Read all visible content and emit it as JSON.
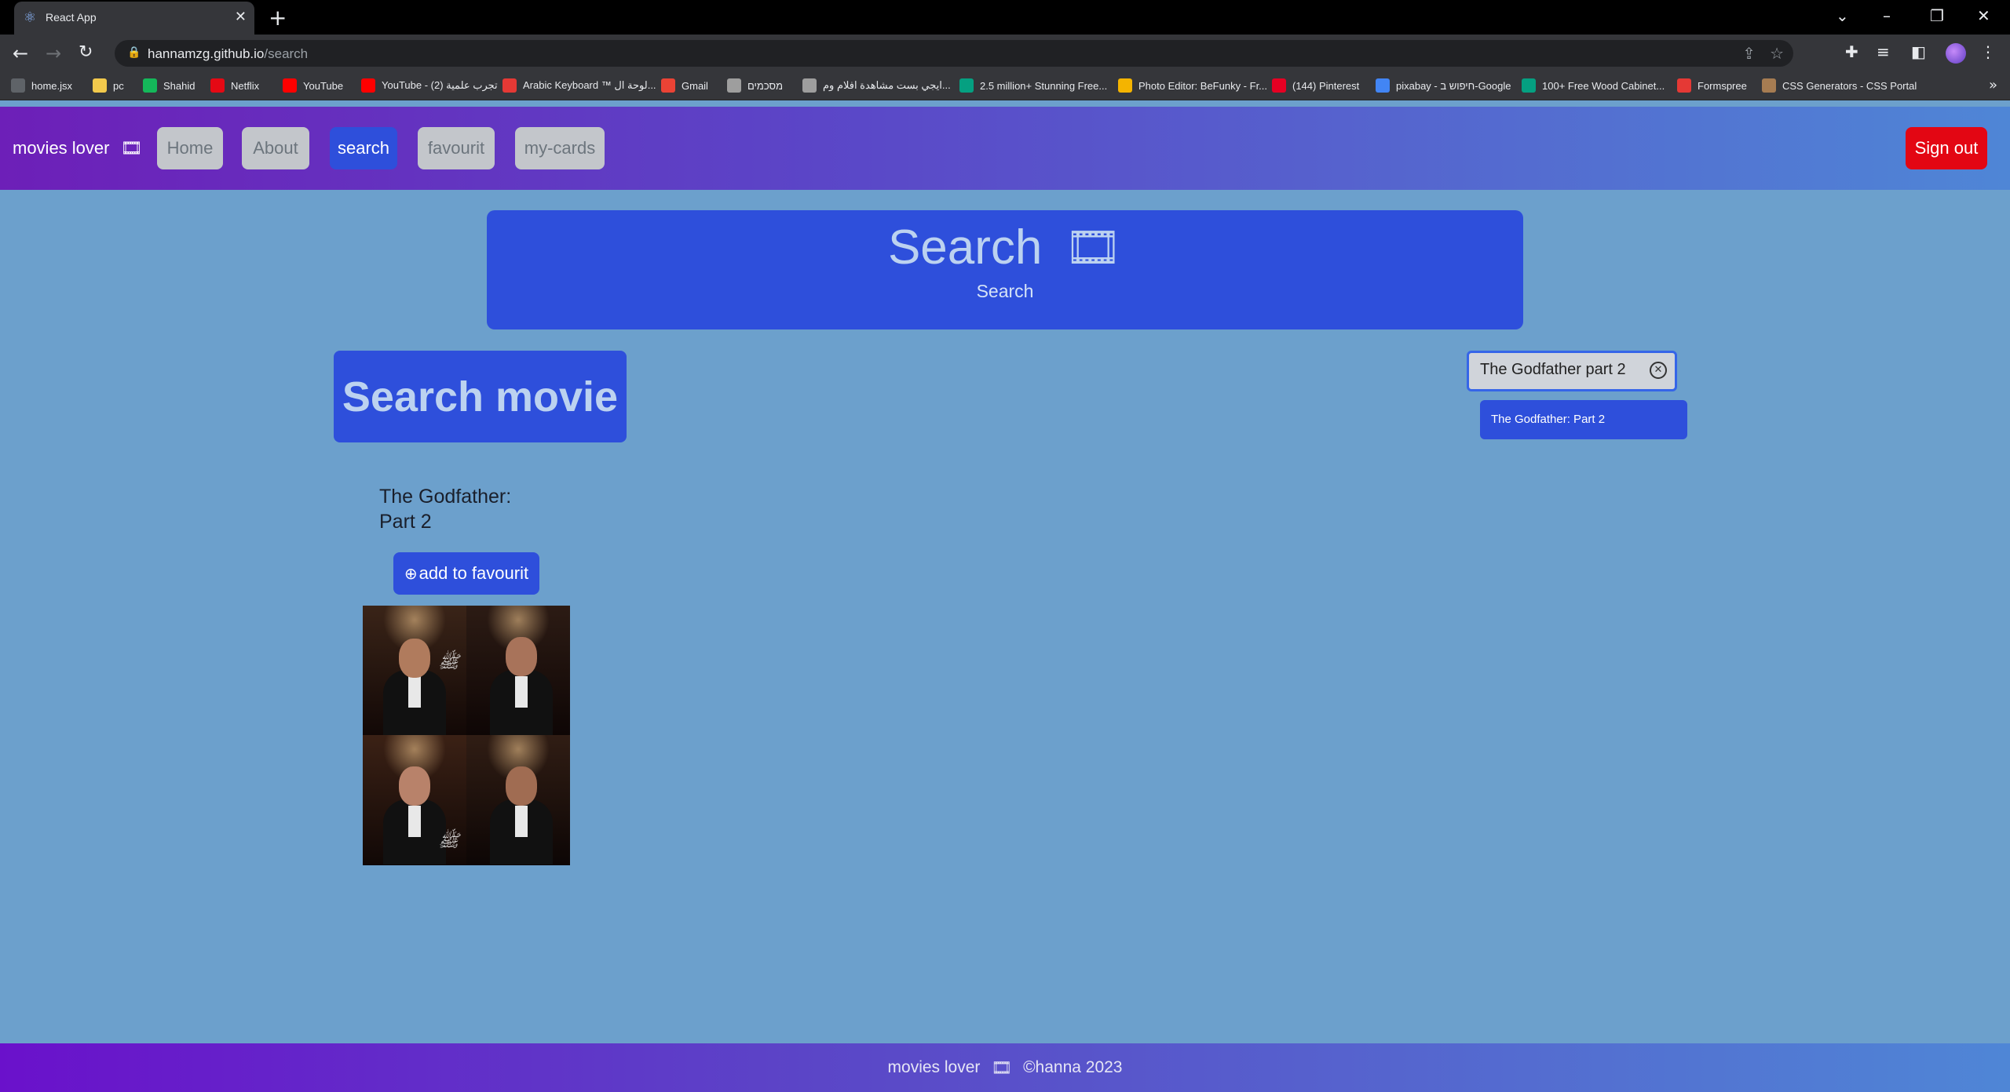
{
  "browser": {
    "tab_title": "React App",
    "url_host": "hannamzg.github.io",
    "url_path": "/search",
    "bookmarks": [
      {
        "label": "home.jsx",
        "color": "#5f6368"
      },
      {
        "label": "pc",
        "color": "#f2c94c"
      },
      {
        "label": "Shahid",
        "color": "#14b85a"
      },
      {
        "label": "Netflix",
        "color": "#e50914"
      },
      {
        "label": "YouTube",
        "color": "#ff0000"
      },
      {
        "label": "YouTube - تجرب علمية (2)",
        "color": "#ff0000"
      },
      {
        "label": "Arabic Keyboard ™ لوحة ال...",
        "color": "#e53935"
      },
      {
        "label": "Gmail",
        "color": "#ea4335"
      },
      {
        "label": "מסכמים",
        "color": "#9e9e9e"
      },
      {
        "label": "ايجي بست مشاهدة افلام وم...",
        "color": "#9e9e9e"
      },
      {
        "label": "2.5 million+ Stunning Free...",
        "color": "#05a081"
      },
      {
        "label": "Photo Editor: BeFunky - Fr...",
        "color": "#f4b400"
      },
      {
        "label": "(144) Pinterest",
        "color": "#e60023"
      },
      {
        "label": "pixabay - חיפוש ב-Google",
        "color": "#4285f4"
      },
      {
        "label": "100+ Free Wood Cabinet...",
        "color": "#05a081"
      },
      {
        "label": "Formspree",
        "color": "#e53935"
      },
      {
        "label": "CSS Generators - CSS Portal",
        "color": "#a67c52"
      }
    ]
  },
  "nav": {
    "brand": "movies lover",
    "items": [
      {
        "label": "Home",
        "active": false
      },
      {
        "label": "About",
        "active": false
      },
      {
        "label": "search",
        "active": true
      },
      {
        "label": "favourit",
        "active": false
      },
      {
        "label": "my-cards",
        "active": false
      }
    ],
    "signout": "Sign out"
  },
  "hero": {
    "title": "Search",
    "subtitle": "Search",
    "icon": "film-icon"
  },
  "search": {
    "heading": "Search movie",
    "input_value": "The Godfather part 2",
    "suggestion": "The Godfather: Part 2"
  },
  "result": {
    "title": "The Godfather: Part 2",
    "fav_label": "add to favourit"
  },
  "footer": {
    "brand": "movies lover",
    "copyright": "©hanna  2023"
  },
  "colors": {
    "page_bg": "#6ca0cc",
    "primary": "#2e4fdb",
    "danger": "#e30613",
    "nav_inactive": "#c3c6cb"
  }
}
